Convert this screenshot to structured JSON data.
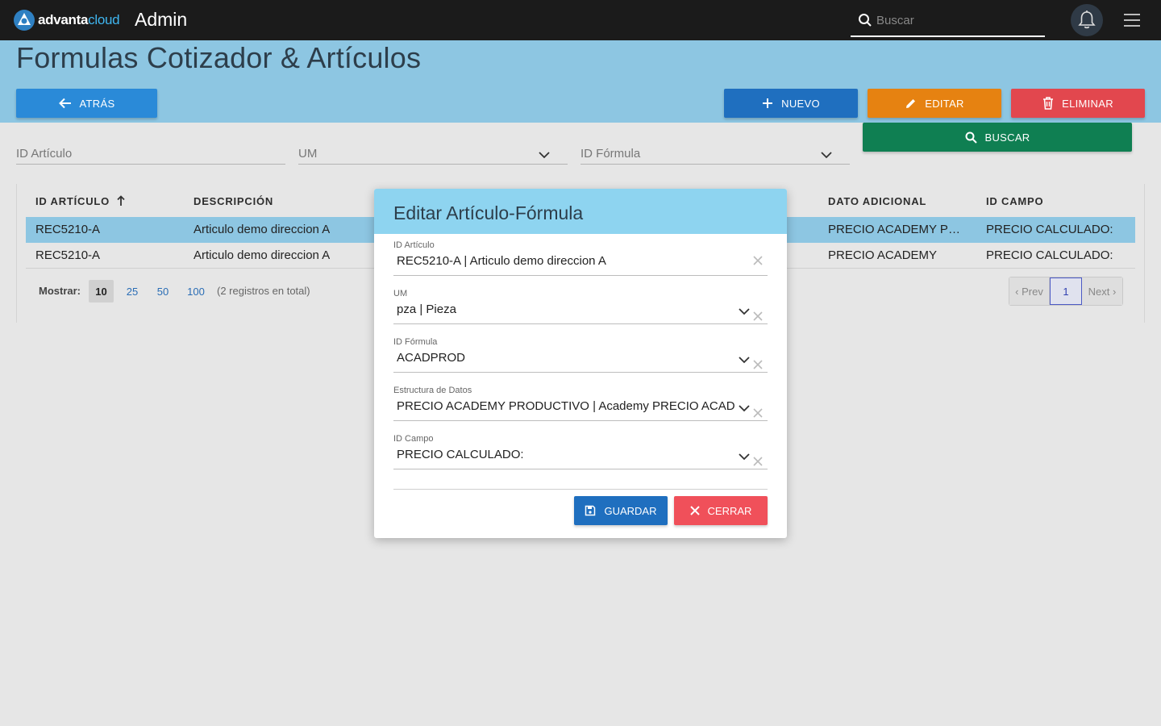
{
  "topbar": {
    "logo_brand": "advanta",
    "logo_cloud": "cloud",
    "app_title": "Admin",
    "search_placeholder": "Buscar",
    "icons": [
      "logo-icon",
      "search-icon",
      "bell-icon",
      "hamburger-menu-icon"
    ]
  },
  "page": {
    "title": "Formulas Cotizador & Artículos",
    "back_label": "ATRÁS",
    "new_label": "NUEVO",
    "edit_label": "EDITAR",
    "delete_label": "ELIMINAR",
    "search_label": "BUSCAR"
  },
  "filters": {
    "id_articulo": "ID Artículo",
    "um": "UM",
    "id_formula": "ID Fórmula"
  },
  "table": {
    "headers": {
      "id_articulo": "ID ARTÍCULO",
      "descripcion": "DESCRIPCIÓN",
      "dato_adicional": "DATO ADICIONAL",
      "id_campo": "ID CAMPO"
    },
    "sort": "ascending",
    "rows": [
      {
        "id": "REC5210-A",
        "descripcion": "Articulo demo direccion A",
        "dato_adicional": "PRECIO ACADEMY PRODUCTIVO",
        "id_campo": "PRECIO CALCULADO:",
        "selected": true
      },
      {
        "id": "REC5210-A",
        "descripcion": "Articulo demo direccion A",
        "dato_adicional": "PRECIO ACADEMY",
        "id_campo": "PRECIO CALCULADO:",
        "selected": false
      }
    ]
  },
  "pagination": {
    "show_label": "Mostrar:",
    "sizes": [
      "10",
      "25",
      "50",
      "100"
    ],
    "active_size": "10",
    "total_text": "(2 registros en total)",
    "prev_label": "‹ Prev",
    "current_page": "1",
    "next_label": "Next ›"
  },
  "modal": {
    "title": "Editar Artículo-Fórmula",
    "fields": [
      {
        "label": "ID Artículo",
        "value": "REC5210-A | Articulo demo direccion A",
        "type": "input"
      },
      {
        "label": "UM",
        "value": "pza | Pieza",
        "type": "select"
      },
      {
        "label": "ID Fórmula",
        "value": "ACADPROD",
        "type": "select"
      },
      {
        "label": "Estructura de Datos",
        "value": "PRECIO ACADEMY PRODUCTIVO | Academy PRECIO ACADEMY PRODUCTIVO",
        "type": "select"
      },
      {
        "label": "ID Campo",
        "value": "PRECIO CALCULADO:",
        "type": "select"
      }
    ],
    "save_label": "GUARDAR",
    "close_label": "CERRAR"
  },
  "colors": {
    "topbar": "#1b1b1b",
    "band": "#8dc6e2",
    "primary": "#1f6fbf",
    "warning": "#e68211",
    "danger": "#e2474e",
    "success": "#0f7f52",
    "modal_header": "#8ed4f0"
  }
}
